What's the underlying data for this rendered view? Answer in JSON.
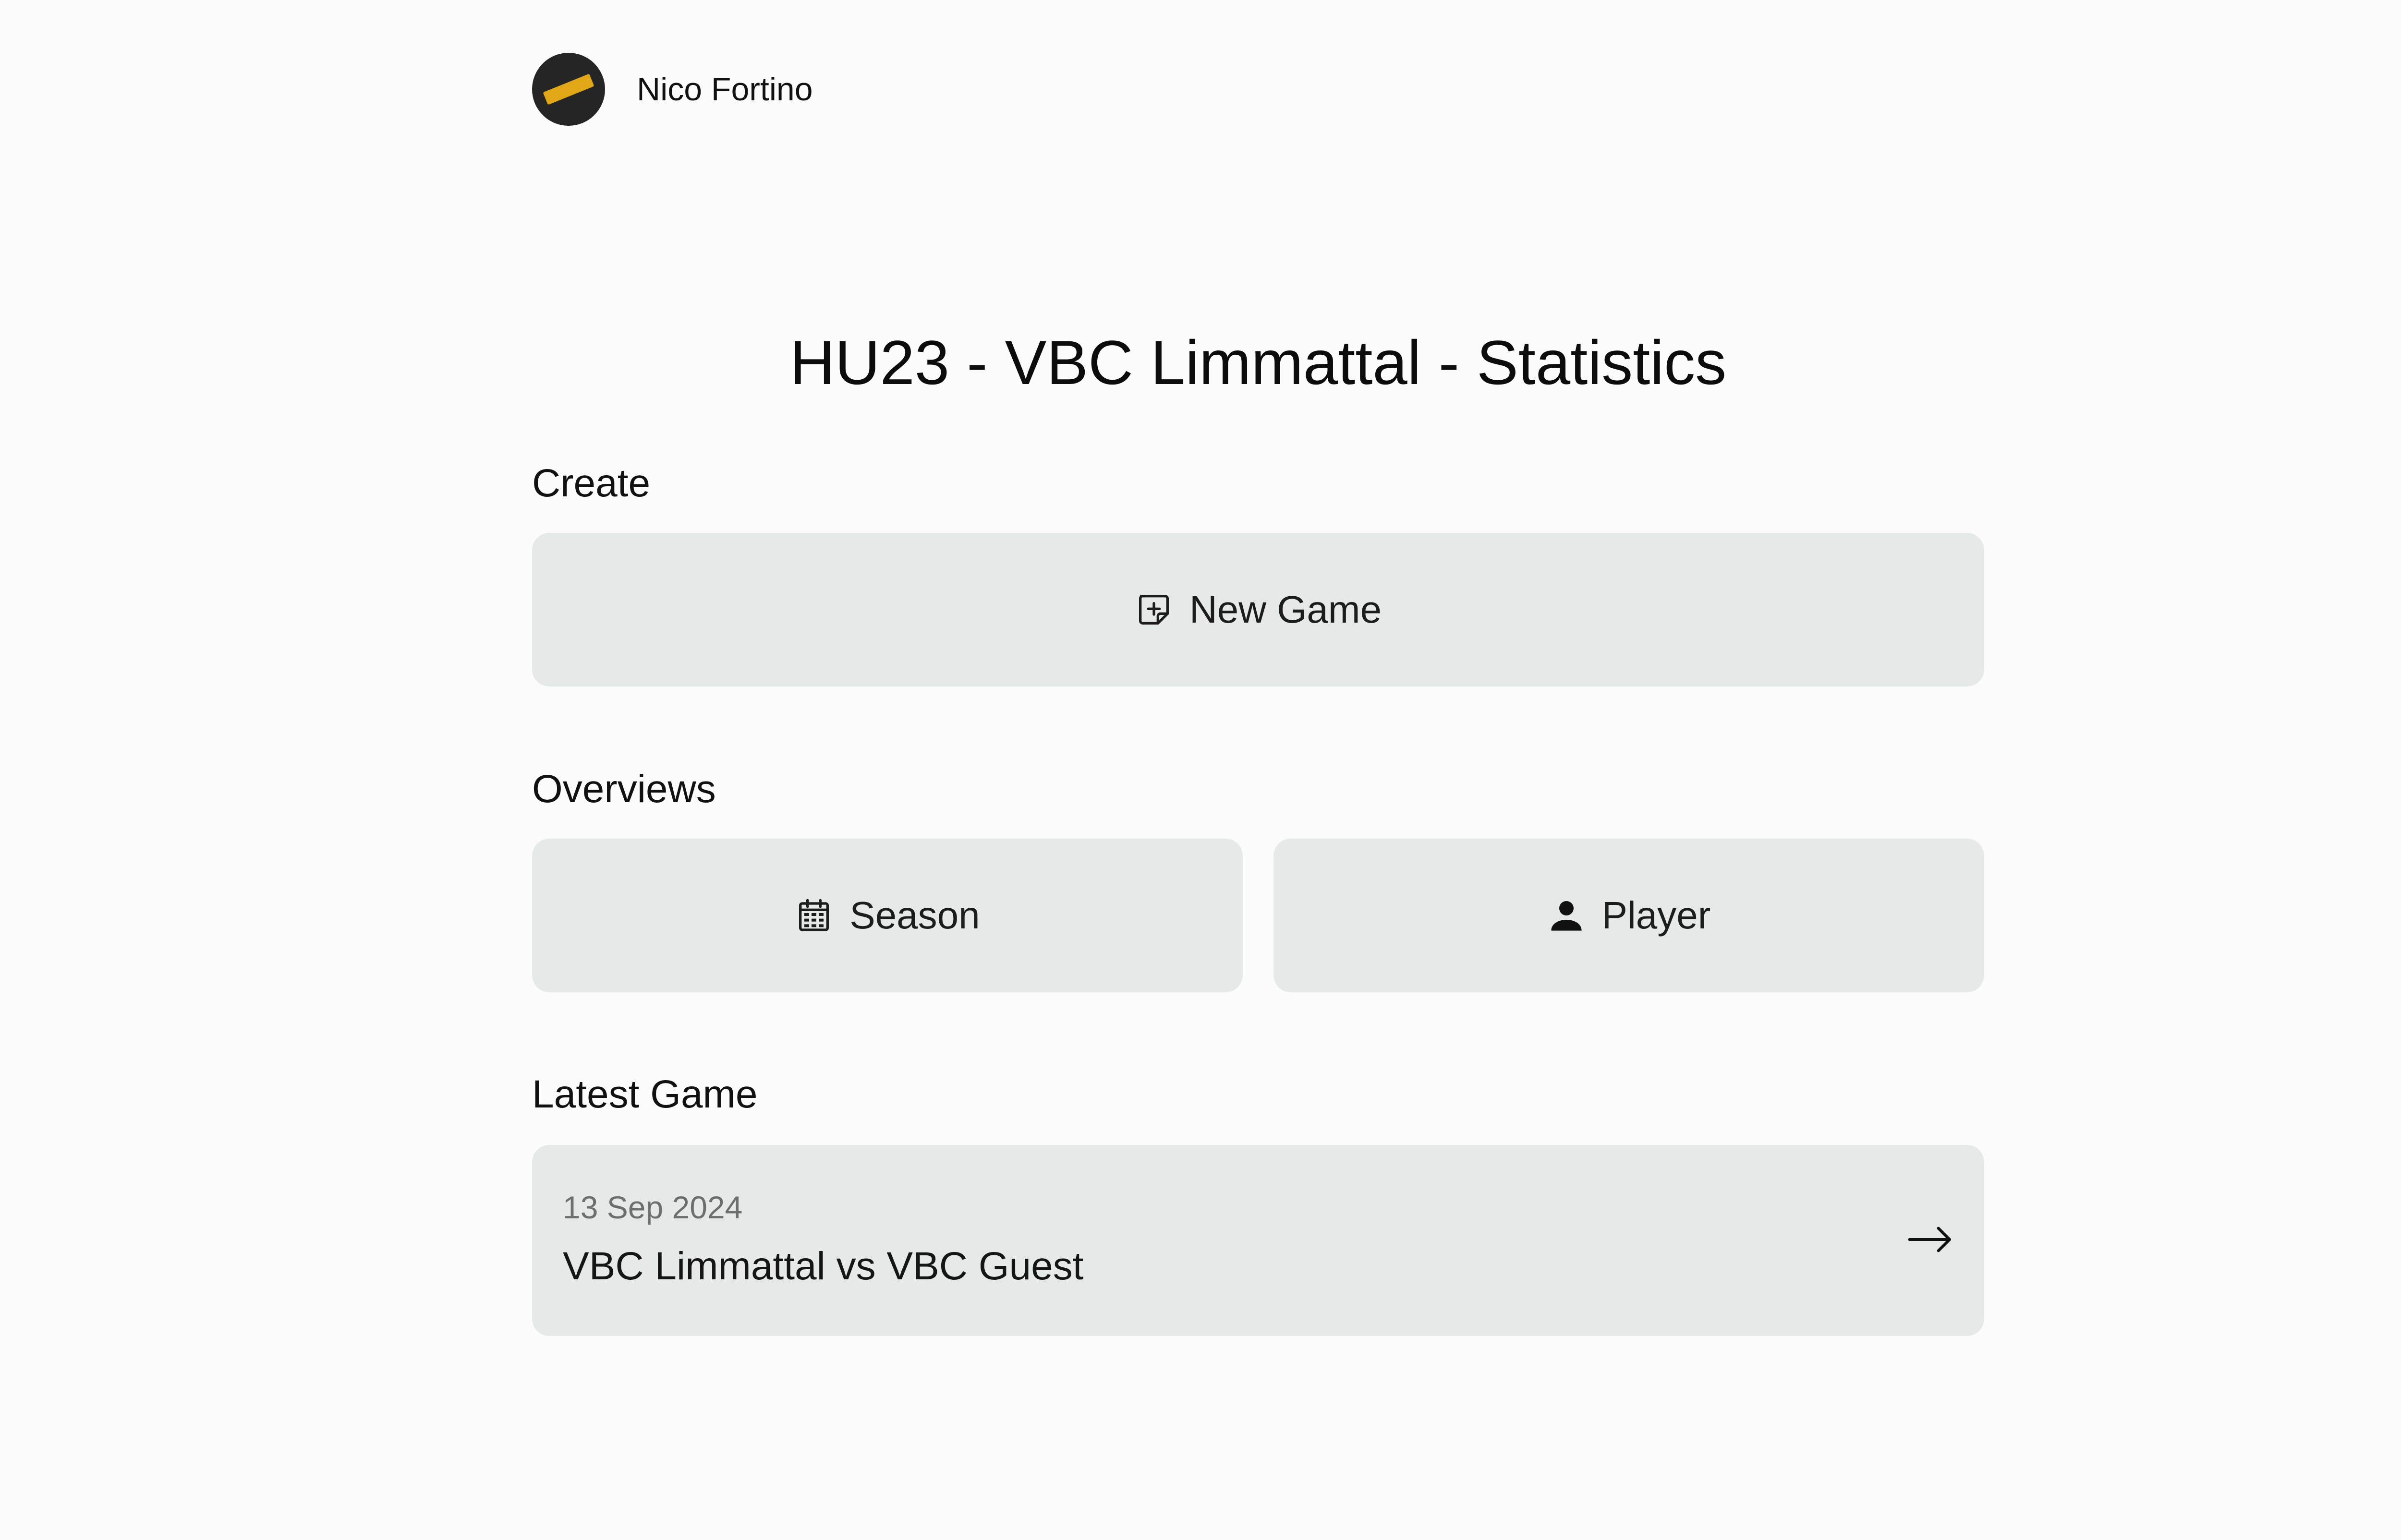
{
  "header": {
    "avatar_icon": "team-logo-icon",
    "username": "Nico Fortino"
  },
  "page": {
    "title": "HU23 - VBC Limmattal - Statistics"
  },
  "create": {
    "label": "Create",
    "new_game": {
      "label": "New Game",
      "icon": "add-note-icon"
    }
  },
  "overviews": {
    "label": "Overviews",
    "season": {
      "label": "Season",
      "icon": "calendar-icon"
    },
    "player": {
      "label": "Player",
      "icon": "person-icon"
    }
  },
  "latest_game": {
    "label": "Latest Game",
    "date": "13 Sep 2024",
    "title": "VBC Limmattal vs VBC Guest",
    "icon": "arrow-right-icon"
  },
  "colors": {
    "background": "#fbfbfb",
    "button_bg": "#e5e9e7",
    "avatar_bg": "#252525",
    "avatar_accent": "#e1a716",
    "muted_text": "#6b6f6e"
  }
}
